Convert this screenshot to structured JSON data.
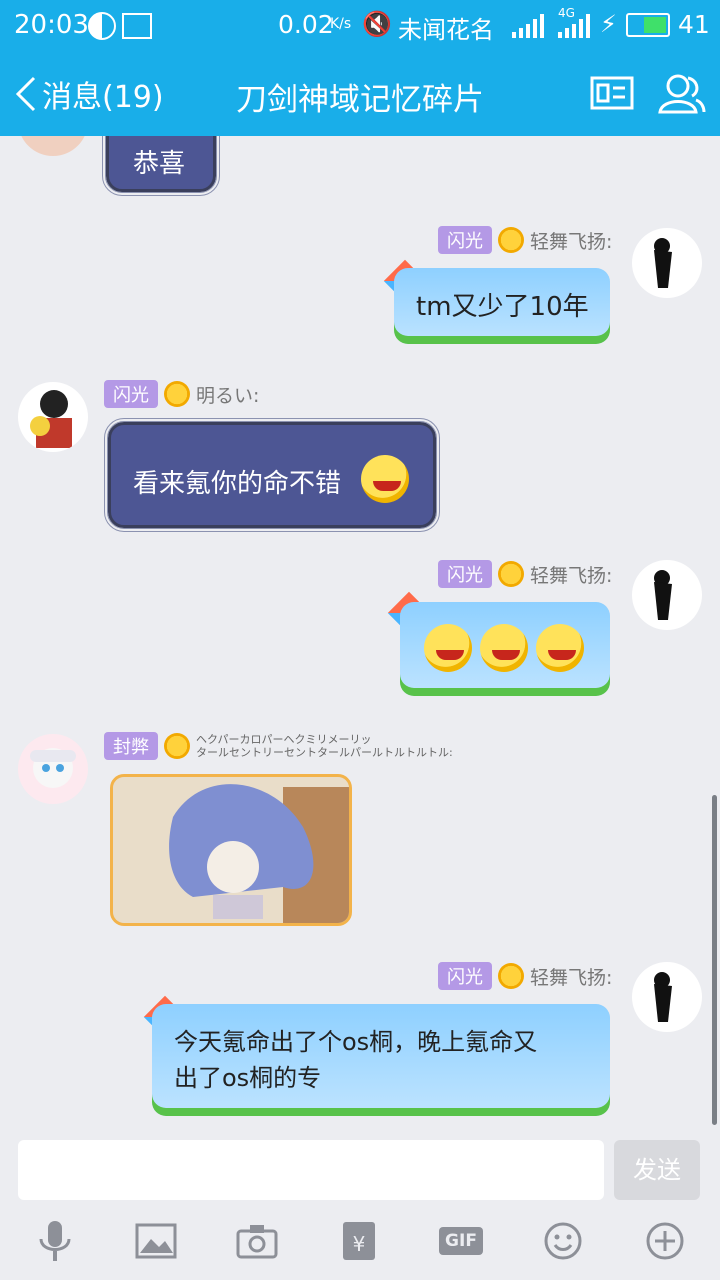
{
  "status_bar": {
    "time": "20:03",
    "speed_value": "0.02",
    "speed_unit": "K/s",
    "carrier": "未闻花名",
    "network": "4G",
    "battery": "41"
  },
  "header": {
    "back_label": "消息(19)",
    "title": "刀剑神域记忆碎片"
  },
  "messages": [
    {
      "text": "恭喜"
    },
    {
      "badge": "闪光",
      "name": "轻舞飞扬:",
      "text": "tm又少了10年"
    },
    {
      "badge": "闪光",
      "name": "明るい:",
      "text": "看来氪你的命不错"
    },
    {
      "badge": "闪光",
      "name": "轻舞飞扬:"
    },
    {
      "badge": "封弊",
      "name_line1": "ヘクパーカロパーヘクミリメーリッ",
      "name_line2": "タールセントリーセントタールパールトルトルトル:"
    },
    {
      "badge": "闪光",
      "name": "轻舞飞扬:",
      "line1": "今天氪命出了个os桐，晚上氪命又",
      "line2": "出了os桐的专"
    }
  ],
  "composer": {
    "input_value": "",
    "send_label": "发送",
    "gif_label": "GIF"
  },
  "icons": [
    "back-icon",
    "contact-card-icon",
    "group-members-icon",
    "mic-icon",
    "image-icon",
    "camera-icon",
    "red-packet-icon",
    "gif-icon",
    "emoji-icon",
    "plus-icon"
  ],
  "colors": {
    "accent": "#19aee9",
    "bubble_blue": "#8ed0ff",
    "bubble_dark": "#4d5694",
    "badge": "#b499e6"
  }
}
